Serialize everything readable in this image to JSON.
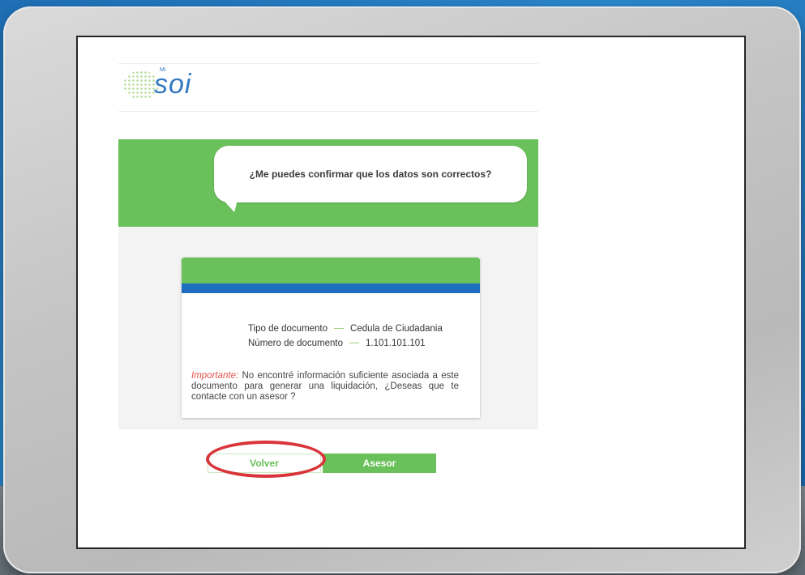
{
  "app": {
    "logo_small": "Mi",
    "logo_text": "soi",
    "message": "¿Me puedes confirmar que los datos son correctos?"
  },
  "card": {
    "tipo_label": "Tipo de documento",
    "tipo_value": "Cedula de Ciudadania",
    "numero_label": "Número de documento",
    "numero_value": "1.101.101.101",
    "important_label": "Importante:",
    "important_text": " No encontré información suficiente asociada a este documento para generar una liquidación, ¿Deseas que te contacte con un asesor ?"
  },
  "buttons": {
    "volver": "Volver",
    "asesor": "Asesor"
  },
  "colors": {
    "green": "#6ac05a",
    "blue": "#1f6fc0",
    "highlight": "#d9343a"
  }
}
